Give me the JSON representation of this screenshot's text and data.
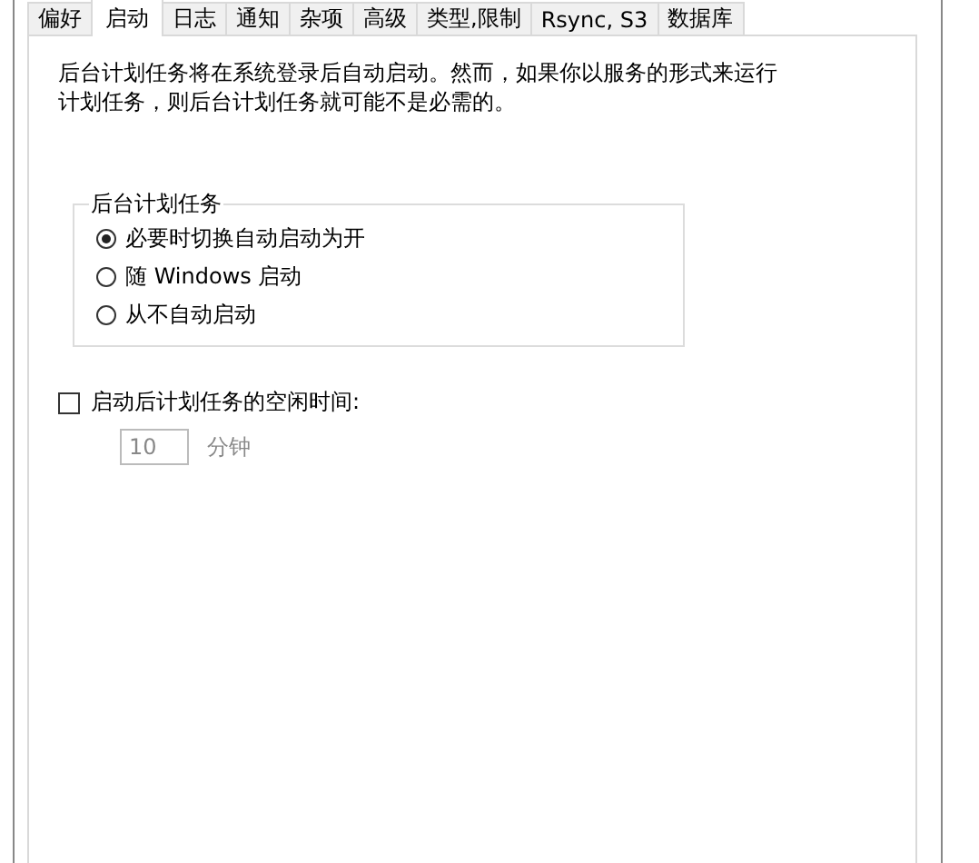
{
  "tabs": [
    {
      "label": "偏好",
      "selected": false
    },
    {
      "label": "启动",
      "selected": true
    },
    {
      "label": "日志",
      "selected": false
    },
    {
      "label": "通知",
      "selected": false
    },
    {
      "label": "杂项",
      "selected": false
    },
    {
      "label": "高级",
      "selected": false
    },
    {
      "label": "类型,限制",
      "selected": false
    },
    {
      "label": "Rsync, S3",
      "selected": false
    },
    {
      "label": "数据库",
      "selected": false
    }
  ],
  "description": "后台计划任务将在系统登录后自动启动。然而，如果你以服务的形式来运行计划任务，则后台计划任务就可能不是必需的。",
  "group": {
    "title": "后台计划任务",
    "options": [
      {
        "label": "必要时切换自动启动为开",
        "selected": true
      },
      {
        "label": "随 Windows 启动",
        "selected": false
      },
      {
        "label": "从不自动启动",
        "selected": false
      }
    ]
  },
  "idle": {
    "label": "启动后计划任务的空闲时间:",
    "checked": false,
    "value": "10",
    "unit": "分钟",
    "disabled": true
  }
}
